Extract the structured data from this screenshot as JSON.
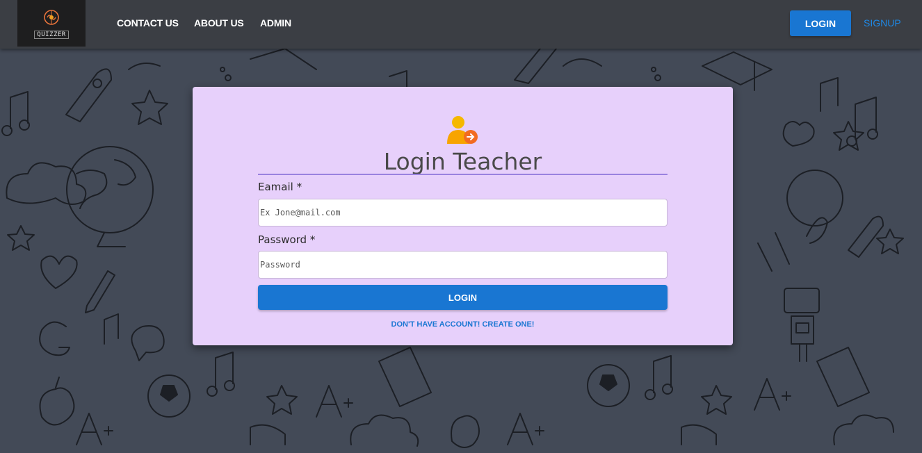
{
  "app": {
    "logo_text": "QUIZZER"
  },
  "nav": {
    "links": [
      "CONTACT US",
      "ABOUT US",
      "ADMIN"
    ],
    "login_label": "LOGIN",
    "signup_label": "SIGNUP"
  },
  "form": {
    "title": "Login Teacher",
    "email_label": "Eamail *",
    "email_placeholder": "Ex Jone@mail.com",
    "password_label": "Password *",
    "password_placeholder": "Password",
    "login_label": "LOGIN",
    "create_link": "DON'T HAVE ACCOUNT! CREATE ONE!"
  },
  "colors": {
    "navbar": "#3b3e44",
    "background": "#434a57",
    "card": "#e7d0fb",
    "primary": "#1976d2",
    "divider": "#9a82df",
    "icon_user": "#f5b800",
    "icon_badge": "#f26b21"
  }
}
